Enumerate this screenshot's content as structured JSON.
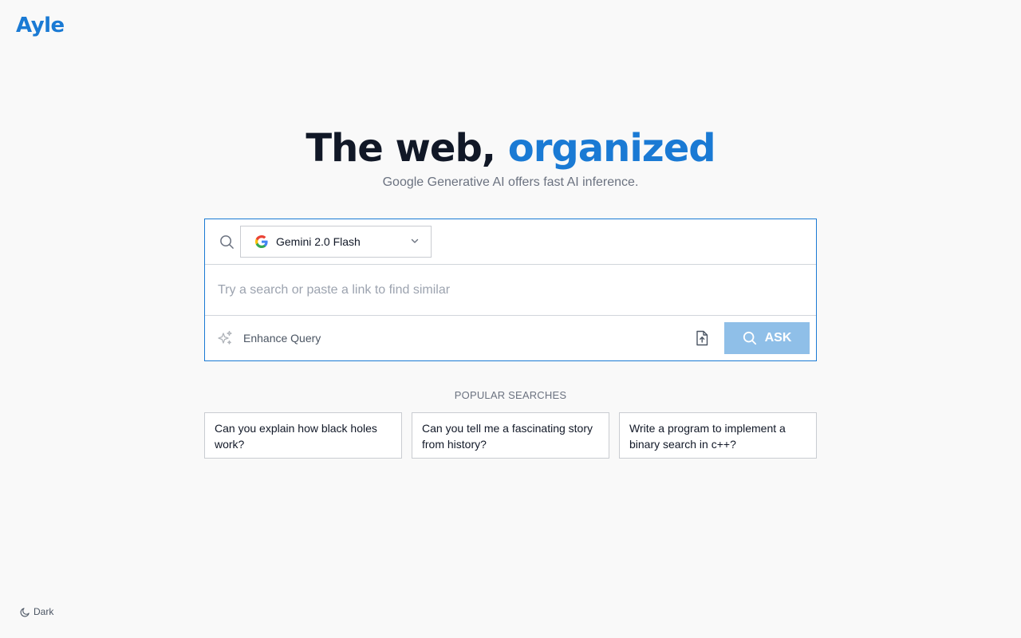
{
  "brand": {
    "logo": "Ayle",
    "accent_color": "#1a7ad4"
  },
  "hero": {
    "title_main": "The web,",
    "title_accent": "organized",
    "subtitle": "Google Generative AI offers fast AI inference."
  },
  "search": {
    "model": {
      "icon": "google-icon",
      "selected": "Gemini 2.0 Flash"
    },
    "input_placeholder": "Try a search or paste a link to find similar",
    "input_value": "",
    "enhance_label": "Enhance Query",
    "ask_label": "ASK"
  },
  "popular": {
    "title": "POPULAR SEARCHES",
    "items": [
      {
        "text": "Can you explain how black holes work?"
      },
      {
        "text": "Can you tell me a fascinating story from history?"
      },
      {
        "text": "Write a program to implement a binary search in c++?"
      }
    ]
  },
  "theme_toggle": {
    "label": "Dark",
    "icon": "moon-icon"
  }
}
